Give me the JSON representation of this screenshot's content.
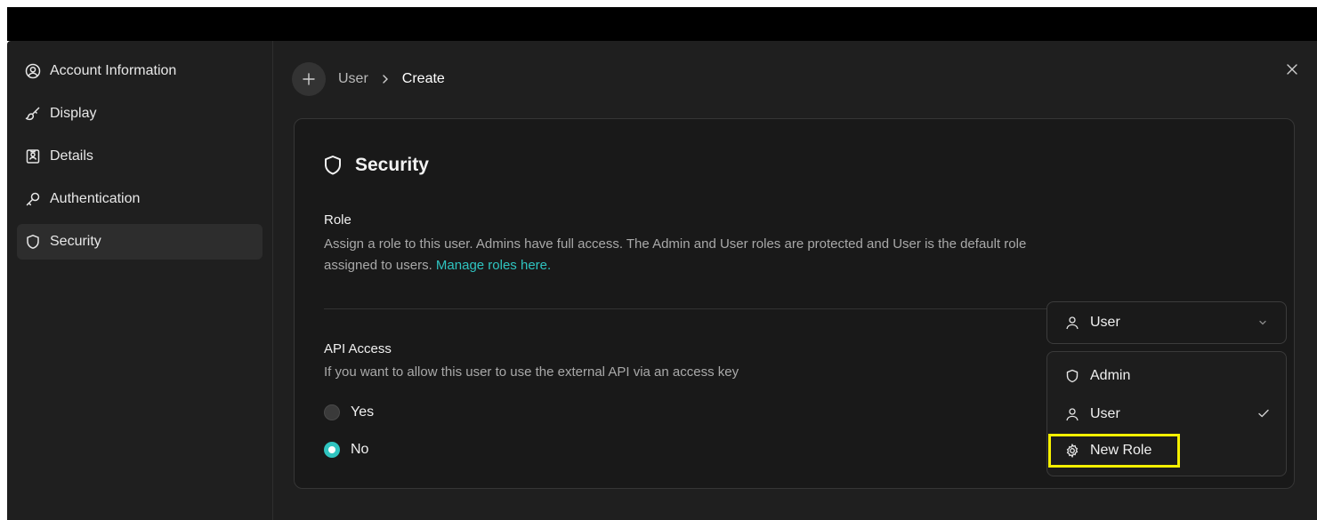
{
  "sidebar": {
    "items": [
      {
        "label": "Account Information",
        "icon": "user-circle-icon"
      },
      {
        "label": "Display",
        "icon": "brush-icon"
      },
      {
        "label": "Details",
        "icon": "id-card-icon"
      },
      {
        "label": "Authentication",
        "icon": "key-icon"
      },
      {
        "label": "Security",
        "icon": "shield-icon",
        "active": true
      }
    ]
  },
  "breadcrumb": {
    "parent": "User",
    "current": "Create"
  },
  "security": {
    "title": "Security",
    "role": {
      "label": "Role",
      "description": "Assign a role to this user. Admins have full access. The Admin and User roles are protected and User is the default role assigned to users.",
      "link_text": "Manage roles here.",
      "selected": "User",
      "options": [
        {
          "label": "Admin",
          "icon": "shield-icon"
        },
        {
          "label": "User",
          "icon": "user-icon",
          "selected": true
        },
        {
          "label": "New Role",
          "icon": "gear-icon",
          "highlighted": true
        }
      ]
    },
    "api": {
      "label": "API Access",
      "description": "If you want to allow this user to use the external API via an access key",
      "options": [
        {
          "label": "Yes",
          "checked": false
        },
        {
          "label": "No",
          "checked": true
        }
      ]
    }
  },
  "colors": {
    "accent": "#2fc4c0",
    "highlight_outline": "#f5f000",
    "background": "#1f1f1f",
    "card": "#191919"
  }
}
